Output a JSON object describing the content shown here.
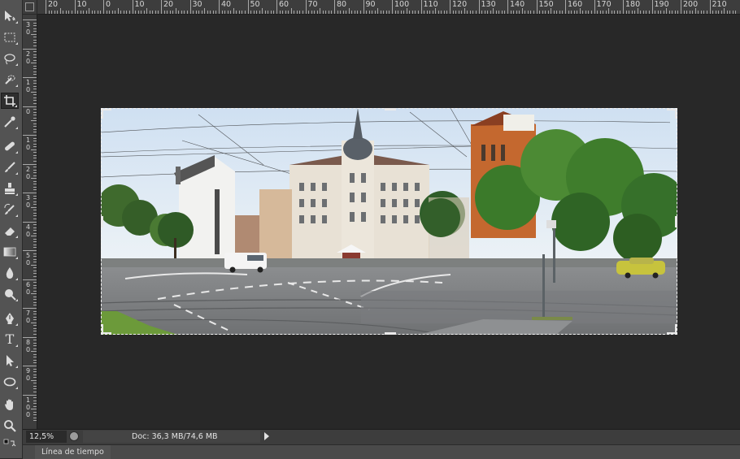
{
  "ruler_h": {
    "labels": [
      "20",
      "10",
      "0",
      "10",
      "20",
      "30",
      "40",
      "50",
      "60",
      "70",
      "80",
      "90",
      "100",
      "110",
      "120",
      "130",
      "140",
      "150",
      "160",
      "170",
      "180",
      "190",
      "200",
      "210"
    ]
  },
  "ruler_v": {
    "labels": [
      [
        "3",
        "0"
      ],
      [
        "2",
        "0"
      ],
      [
        "1",
        "0"
      ],
      [
        "0"
      ],
      [
        "1",
        "0"
      ],
      [
        "2",
        "0"
      ],
      [
        "3",
        "0"
      ],
      [
        "4",
        "0"
      ],
      [
        "5",
        "0"
      ],
      [
        "6",
        "0"
      ],
      [
        "7",
        "0"
      ],
      [
        "8",
        "0"
      ],
      [
        "9",
        "0"
      ],
      [
        "1",
        "0",
        "0"
      ]
    ]
  },
  "tools": [
    {
      "name": "move-tool",
      "icon": "move-icon"
    },
    {
      "name": "marquee-tool",
      "icon": "rect-marquee-icon"
    },
    {
      "name": "lasso-tool",
      "icon": "lasso-icon"
    },
    {
      "name": "quick-select-tool",
      "icon": "quick-select-icon"
    },
    {
      "name": "crop-tool",
      "icon": "crop-icon",
      "active": true
    },
    {
      "name": "eyedropper-tool",
      "icon": "eyedropper-icon"
    },
    {
      "name": "healing-tool",
      "icon": "bandage-icon"
    },
    {
      "name": "brush-tool",
      "icon": "brush-icon"
    },
    {
      "name": "stamp-tool",
      "icon": "stamp-icon"
    },
    {
      "name": "history-brush-tool",
      "icon": "history-brush-icon"
    },
    {
      "name": "eraser-tool",
      "icon": "eraser-icon"
    },
    {
      "name": "gradient-tool",
      "icon": "gradient-icon"
    },
    {
      "name": "blur-tool",
      "icon": "drop-icon"
    },
    {
      "name": "dodge-tool",
      "icon": "dodge-icon"
    },
    {
      "name": "pen-tool",
      "icon": "pen-icon"
    },
    {
      "name": "type-tool",
      "icon": "type-icon"
    },
    {
      "name": "path-select-tool",
      "icon": "arrow-select-icon"
    },
    {
      "name": "shape-tool",
      "icon": "ellipse-icon"
    },
    {
      "name": "hand-tool",
      "icon": "hand-icon"
    },
    {
      "name": "zoom-tool",
      "icon": "zoom-icon"
    }
  ],
  "type_tool_glyph": "T",
  "status": {
    "zoom": "12,5%",
    "doc": "Doc: 36,3 MB/74,6 MB"
  },
  "timeline": {
    "tab_label": "Línea de tiempo"
  },
  "colors": {
    "workspace": "#282828",
    "panel": "#535353",
    "ruler": "#3d3d3d"
  }
}
